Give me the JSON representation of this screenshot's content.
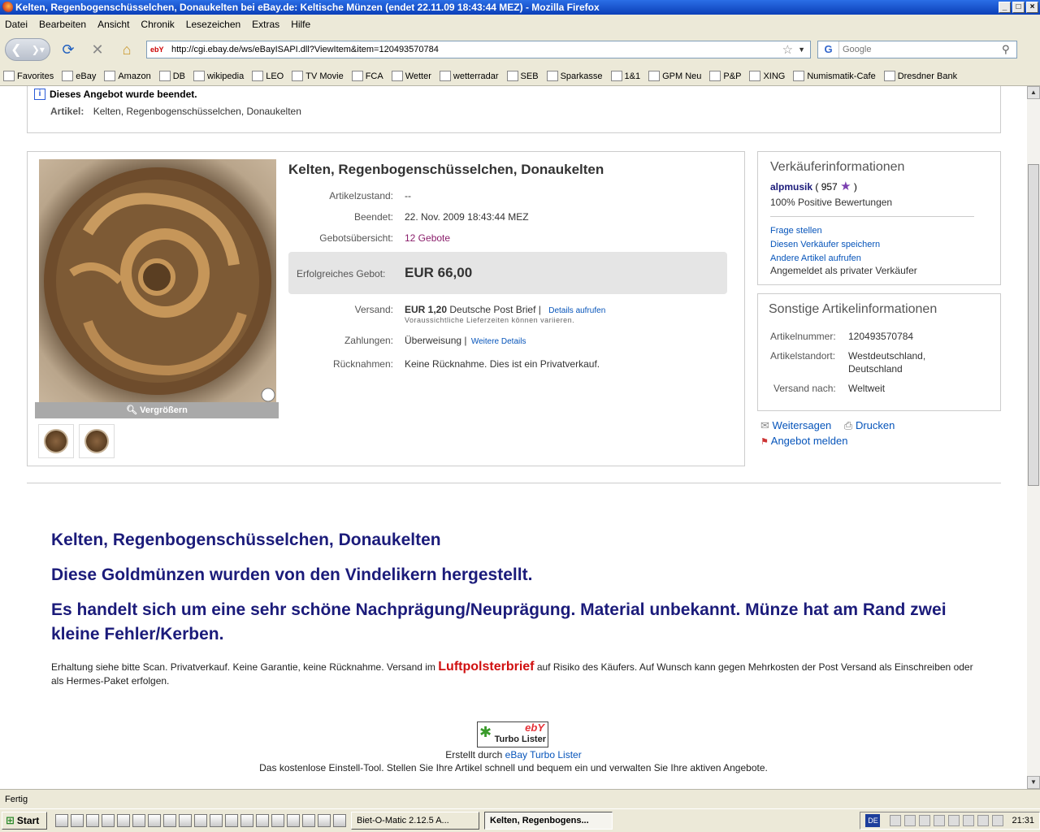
{
  "window": {
    "title": "Kelten, Regenbogenschüsselchen, Donaukelten bei eBay.de: Keltische Münzen (endet 22.11.09 18:43:44 MEZ) - Mozilla Firefox"
  },
  "menu": {
    "datei": "Datei",
    "bearbeiten": "Bearbeiten",
    "ansicht": "Ansicht",
    "chronik": "Chronik",
    "lesezeichen": "Lesezeichen",
    "extras": "Extras",
    "hilfe": "Hilfe"
  },
  "nav": {
    "url": "http://cgi.ebay.de/ws/eBayISAPI.dll?ViewItem&item=120493570784",
    "site_label": "ebY",
    "search_placeholder": "Google",
    "search_engine": "G"
  },
  "bookmarks": [
    {
      "label": "Favorites",
      "icon": "folder-icon"
    },
    {
      "label": "eBay",
      "icon": "ebay-icon"
    },
    {
      "label": "Amazon",
      "icon": "amazon-icon"
    },
    {
      "label": "DB",
      "icon": "db-icon"
    },
    {
      "label": "wikipedia",
      "icon": "wikipedia-icon"
    },
    {
      "label": "LEO",
      "icon": "leo-icon"
    },
    {
      "label": "TV Movie",
      "icon": "star-icon"
    },
    {
      "label": "FCA",
      "icon": "fca-icon"
    },
    {
      "label": "Wetter",
      "icon": "wetter-icon"
    },
    {
      "label": "wetterradar",
      "icon": "radar-icon"
    },
    {
      "label": "SEB",
      "icon": "seb-icon"
    },
    {
      "label": "Sparkasse",
      "icon": "sparkasse-icon"
    },
    {
      "label": "1&1",
      "icon": "page-icon"
    },
    {
      "label": "GPM Neu",
      "icon": "mail-icon"
    },
    {
      "label": "P&P",
      "icon": "page-icon"
    },
    {
      "label": "XING",
      "icon": "xing-icon"
    },
    {
      "label": "Numismatik-Cafe",
      "icon": "page-icon"
    },
    {
      "label": "Dresdner Bank",
      "icon": "dresdner-icon"
    }
  ],
  "notice": {
    "ended": "Dieses Angebot wurde beendet.",
    "artikel_label": "Artikel:",
    "artikel_value": "Kelten, Regenbogenschüsselchen, Donaukelten"
  },
  "item": {
    "title": "Kelten, Regenbogenschüsselchen, Donaukelten",
    "zoom_label": "Vergrößern",
    "fields": {
      "zustand_label": "Artikelzustand:",
      "zustand_value": "--",
      "beendet_label": "Beendet:",
      "beendet_value": "22. Nov. 2009 18:43:44 MEZ",
      "gebot_label": "Gebotsübersicht:",
      "gebot_value": "12 Gebote",
      "erfolg_label": "Erfolgreiches Gebot:",
      "erfolg_value": "EUR 66,00",
      "versand_label": "Versand:",
      "versand_price": "EUR 1,20",
      "versand_method": "Deutsche Post Brief |",
      "versand_details": "Details aufrufen",
      "versand_note": "Voraussichtliche Lieferzeiten können variieren.",
      "zahlung_label": "Zahlungen:",
      "zahlung_value": "Überweisung |",
      "zahlung_details": "Weitere Details",
      "ruecknahme_label": "Rücknahmen:",
      "ruecknahme_value": "Keine Rücknahme. Dies ist ein Privatverkauf."
    }
  },
  "seller": {
    "heading": "Verkäuferinformationen",
    "name": "alpmusik",
    "score_open": "( 957",
    "score_close": ")",
    "positive": "100% Positive Bewertungen",
    "ask": "Frage stellen",
    "save": "Diesen Verkäufer speichern",
    "other": "Andere Artikel aufrufen",
    "private": "Angemeldet als privater Verkäufer"
  },
  "other_info": {
    "heading": "Sonstige Artikelinformationen",
    "nummer_label": "Artikelnummer:",
    "nummer_value": "120493570784",
    "standort_label": "Artikelstandort:",
    "standort_value1": "Westdeutschland,",
    "standort_value2": "Deutschland",
    "versand_label": "Versand nach:",
    "versand_value": "Weltweit"
  },
  "actions": {
    "share": "Weitersagen",
    "print": "Drucken",
    "report": "Angebot melden"
  },
  "description": {
    "line1": "Kelten, Regenbogenschüsselchen, Donaukelten",
    "line2": "Diese Goldmünzen wurden von den Vindelikern hergestellt.",
    "line3": "Es handelt sich um eine sehr schöne Nachprägung/Neuprägung. Material unbekannt. Münze hat am Rand zwei kleine Fehler/Kerben.",
    "small_before": "Erhaltung siehe bitte Scan. Privatverkauf. Keine Garantie, keine Rücknahme. Versand im",
    "small_red": "Luftpolsterbrief",
    "small_after": "auf Risiko des Käufers. Auf Wunsch kann gegen Mehrkosten der Post Versand als Einschreiben oder als Hermes-Paket erfolgen."
  },
  "turbo": {
    "logo_top": "ebY",
    "logo_bottom": "Turbo Lister",
    "created_prefix": "Erstellt durch",
    "created_link": "eBay Turbo Lister",
    "tagline": "Das kostenlose Einstell-Tool. Stellen Sie Ihre Artikel schnell und bequem ein und verwalten Sie Ihre aktiven Angebote."
  },
  "status": {
    "text": "Fertig"
  },
  "taskbar": {
    "start": "Start",
    "task1": "Biet-O-Matic 2.12.5    A...",
    "task2": "Kelten, Regenbogens...",
    "lang": "DE",
    "clock": "21:31"
  }
}
